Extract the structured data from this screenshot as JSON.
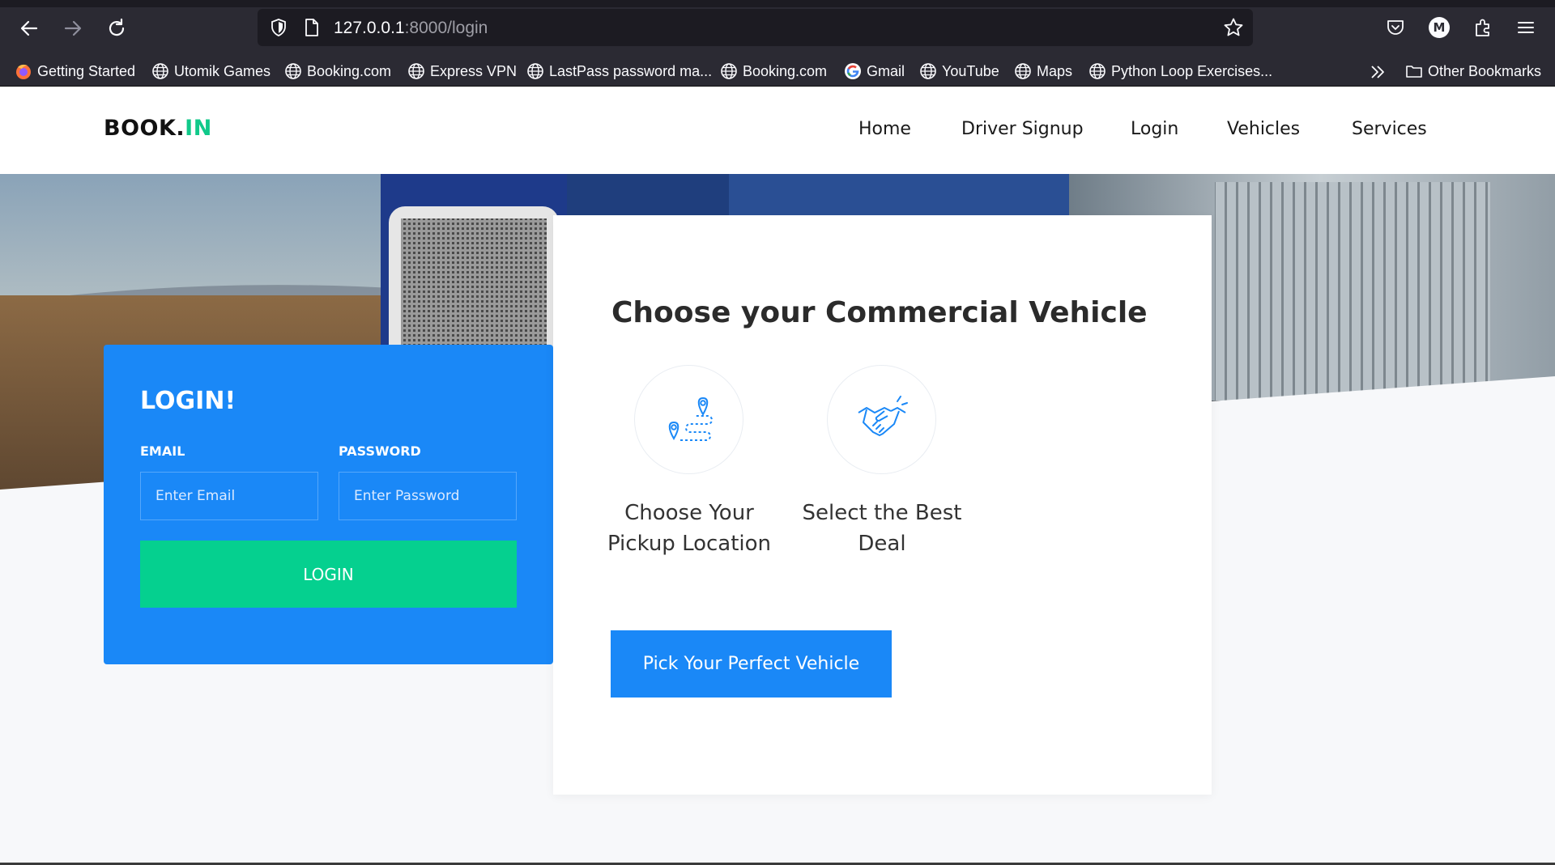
{
  "browser": {
    "url_host": "127.0.0.1",
    "url_path": ":8000/login",
    "bookmarks": [
      {
        "label": "Getting Started",
        "icon": "firefox-icon"
      },
      {
        "label": "Utomik Games",
        "icon": "globe-icon"
      },
      {
        "label": "Booking.com",
        "icon": "globe-icon"
      },
      {
        "label": "Express VPN",
        "icon": "globe-icon"
      },
      {
        "label": "LastPass password ma...",
        "icon": "globe-icon"
      },
      {
        "label": "Booking.com",
        "icon": "globe-icon"
      },
      {
        "label": "Gmail",
        "icon": "google-icon"
      },
      {
        "label": "YouTube",
        "icon": "globe-icon"
      },
      {
        "label": "Maps",
        "icon": "globe-icon"
      },
      {
        "label": "Python Loop Exercises...",
        "icon": "globe-icon"
      }
    ],
    "other_bookmarks": "Other Bookmarks",
    "account_initial": "M"
  },
  "site": {
    "logo_main": "BOOK.",
    "logo_accent": "IN",
    "nav": [
      "Home",
      "Driver Signup",
      "Login",
      "Vehicles",
      "Services"
    ]
  },
  "login": {
    "title": "LOGIN!",
    "email_label": "EMAIL",
    "email_placeholder": "Enter Email",
    "password_label": "PASSWORD",
    "password_placeholder": "Enter Password",
    "button": "LOGIN"
  },
  "feature": {
    "title": "Choose your Commercial Vehicle",
    "items": [
      {
        "label": "Choose Your Pickup Location",
        "icon": "map-route-icon"
      },
      {
        "label": "Select the Best Deal",
        "icon": "handshake-icon"
      }
    ],
    "button": "Pick Your Perfect Vehicle"
  },
  "colors": {
    "primary": "#1a88f7",
    "accent": "#05d08f",
    "logo_accent": "#10c98a"
  }
}
